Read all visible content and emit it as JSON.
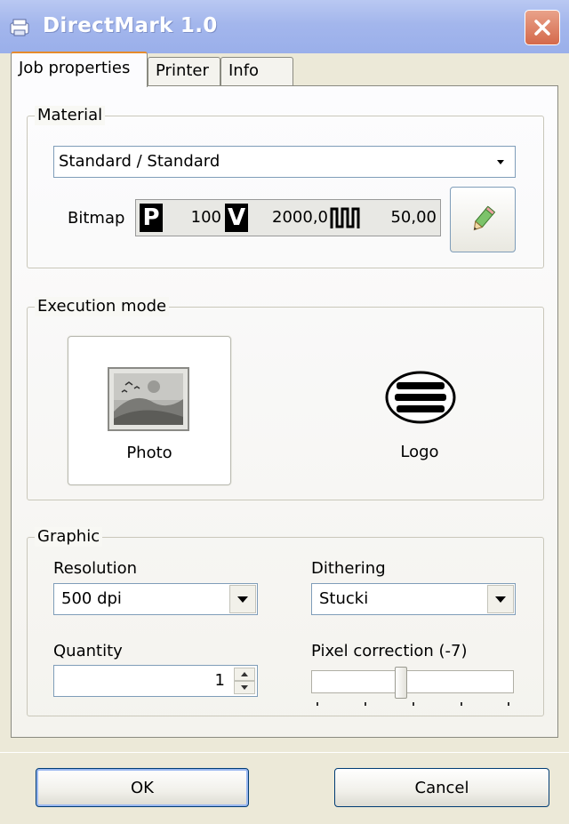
{
  "window": {
    "title": "DirectMark 1.0"
  },
  "tabs": [
    {
      "label": "Job properties",
      "active": true
    },
    {
      "label": "Printer",
      "active": false
    },
    {
      "label": "Info",
      "active": false
    }
  ],
  "material": {
    "legend": "Material",
    "selected": "Standard / Standard",
    "bitmap_label": "Bitmap",
    "p_icon": "P",
    "p_value": "100",
    "v_icon": "V",
    "v_value": "2000,0",
    "freq_value": "50,00",
    "edit_icon": "pencil-icon"
  },
  "execution": {
    "legend": "Execution mode",
    "photo_label": "Photo",
    "logo_label": "Logo",
    "selected": "Photo"
  },
  "graphic": {
    "legend": "Graphic",
    "resolution_label": "Resolution",
    "resolution_value": "500 dpi",
    "dithering_label": "Dithering",
    "dithering_value": "Stucki",
    "quantity_label": "Quantity",
    "quantity_value": "1",
    "pixel_label": "Pixel correction (-7)",
    "pixel_slider_fraction": 0.44
  },
  "buttons": {
    "ok": "OK",
    "cancel": "Cancel"
  },
  "colors": {
    "titlebar": "#A3B6EC",
    "close": "#D4694B",
    "active_tab_accent": "#E68B2C"
  }
}
